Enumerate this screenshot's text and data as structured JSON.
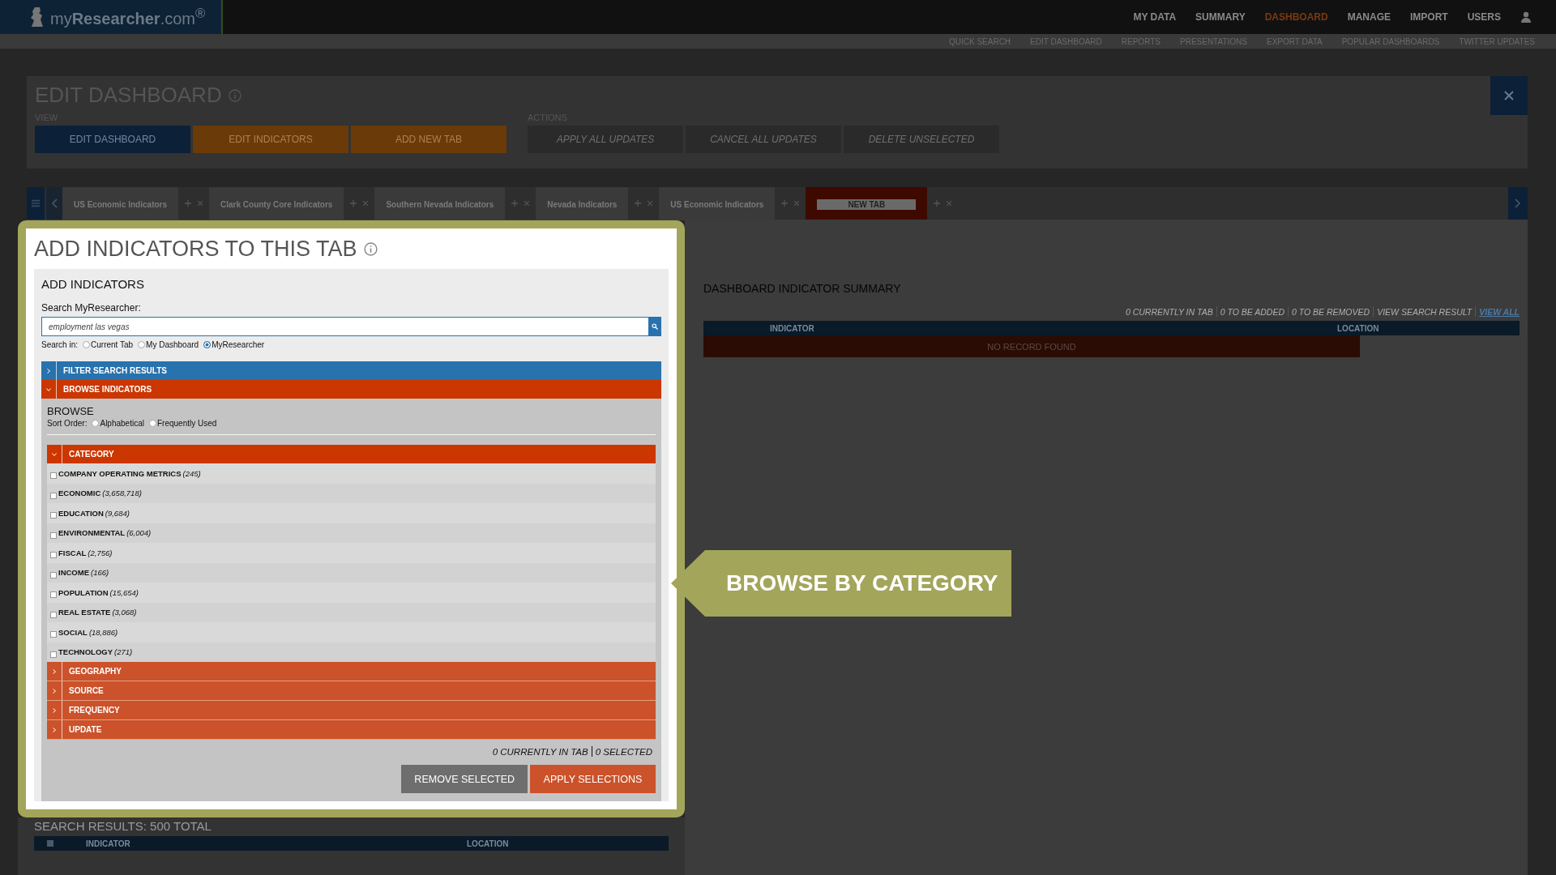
{
  "logo": {
    "text": "my**Researcher**.com$^{®}$"
  },
  "nav": [
    {
      "label": "MY DATA",
      "selected": false
    },
    {
      "label": "SUMMARY",
      "selected": false
    },
    {
      "label": "DASHBOARD",
      "selected": true
    },
    {
      "label": "MANAGE",
      "selected": false
    },
    {
      "label": "IMPORT",
      "selected": false
    },
    {
      "label": "USERS",
      "selected": false
    }
  ],
  "subnav": [
    "QUICK SEARCH",
    "EDIT DASHBOARD",
    "REPORTS",
    "PRESENTATIONS",
    "EXPORT DATA",
    "POPULAR DASHBOARDS",
    "TWITTER UPDATES"
  ],
  "edit_dashboard": {
    "title": "EDIT DASHBOARD",
    "view_label": "VIEW",
    "view_buttons": [
      {
        "label": "EDIT DASHBOARD",
        "selected": true
      },
      {
        "label": "EDIT INDICATORS",
        "selected": false
      },
      {
        "label": "ADD NEW TAB",
        "selected": false
      }
    ],
    "actions_label": "ACTIONS",
    "action_buttons": [
      {
        "label": "APPLY ALL UPDATES",
        "disabled": true
      },
      {
        "label": "CANCEL ALL UPDATES",
        "disabled": true
      },
      {
        "label": "DELETE UNSELECTED",
        "disabled": true
      }
    ]
  },
  "tabs": [
    {
      "label": "US Economic Indicators",
      "selected": false
    },
    {
      "label": "Clark County Core Indicators",
      "selected": false
    },
    {
      "label": "Southern Nevada Indicators",
      "selected": false
    },
    {
      "label": "Nevada Indicators",
      "selected": false
    },
    {
      "label": "US Economic Indicators",
      "selected": false
    },
    {
      "label": "NEW TAB",
      "selected": true
    }
  ],
  "add_panel": {
    "title": "ADD INDICATORS TO THIS TAB",
    "section_title": "ADD INDICATORS",
    "search_label": "Search MyResearcher:",
    "search_value": "employment las vegas",
    "search_in_label": "Search in:",
    "search_in": [
      {
        "label": "Current Tab",
        "selected": false
      },
      {
        "label": "My Dashboard",
        "selected": false
      },
      {
        "label": "MyResearcher",
        "selected": true
      }
    ],
    "sections": [
      {
        "label": "FILTER SEARCH RESULTS",
        "expanded": false,
        "color": "#2872ad"
      },
      {
        "label": "BROWSE INDICATORS",
        "expanded": true,
        "color": "#cc3600"
      }
    ],
    "browse": {
      "title": "BROWSE",
      "sort_label": "Sort Order:",
      "sort_options": [
        {
          "label": "Alphabetical",
          "selected": false
        },
        {
          "label": "Frequently Used",
          "selected": false
        }
      ],
      "groups": [
        {
          "label": "CATEGORY",
          "expanded": true,
          "items": [
            {
              "name": "COMPANY OPERATING METRICS",
              "count": "(245)",
              "checked": false
            },
            {
              "name": "ECONOMIC",
              "count": "(3,658,718)",
              "checked": false
            },
            {
              "name": "EDUCATION",
              "count": "(9,684)",
              "checked": false
            },
            {
              "name": "ENVIRONMENTAL",
              "count": "(6,004)",
              "checked": false
            },
            {
              "name": "FISCAL",
              "count": "(2,756)",
              "checked": false
            },
            {
              "name": "INCOME",
              "count": "(166)",
              "checked": false
            },
            {
              "name": "POPULATION",
              "count": "(15,654)",
              "checked": false
            },
            {
              "name": "REAL ESTATE",
              "count": "(3,068)",
              "checked": false
            },
            {
              "name": "SOCIAL",
              "count": "(18,886)",
              "checked": false
            },
            {
              "name": "TECHNOLOGY",
              "count": "(271)",
              "checked": false
            }
          ]
        },
        {
          "label": "GEOGRAPHY",
          "expanded": false
        },
        {
          "label": "SOURCE",
          "expanded": false
        },
        {
          "label": "FREQUENCY",
          "expanded": false
        },
        {
          "label": "UPDATE",
          "expanded": false
        }
      ]
    },
    "status": [
      "0 CURRENTLY IN TAB",
      "0 SELECTED"
    ],
    "buttons": [
      {
        "label": "REMOVE SELECTED",
        "kind": "secondary"
      },
      {
        "label": "APPLY SELECTIONS",
        "kind": "primary"
      }
    ]
  },
  "search_results": {
    "title": "SEARCH RESULTS: 500 TOTAL",
    "select_all": {
      "checked": false
    },
    "columns": [
      "INDICATOR",
      "LOCATION"
    ]
  },
  "summary": {
    "title": "DASHBOARD INDICATOR SUMMARY",
    "stats": [
      "0 CURRENTLY IN TAB",
      "0 TO BE ADDED",
      "0 TO BE REMOVED",
      "VIEW SEARCH RESULT"
    ],
    "link": "VIEW ALL",
    "columns": [
      "INDICATOR",
      "LOCATION"
    ],
    "empty": "NO RECORD FOUND"
  },
  "callout": {
    "text": "BROWSE BY CATEGORY"
  }
}
